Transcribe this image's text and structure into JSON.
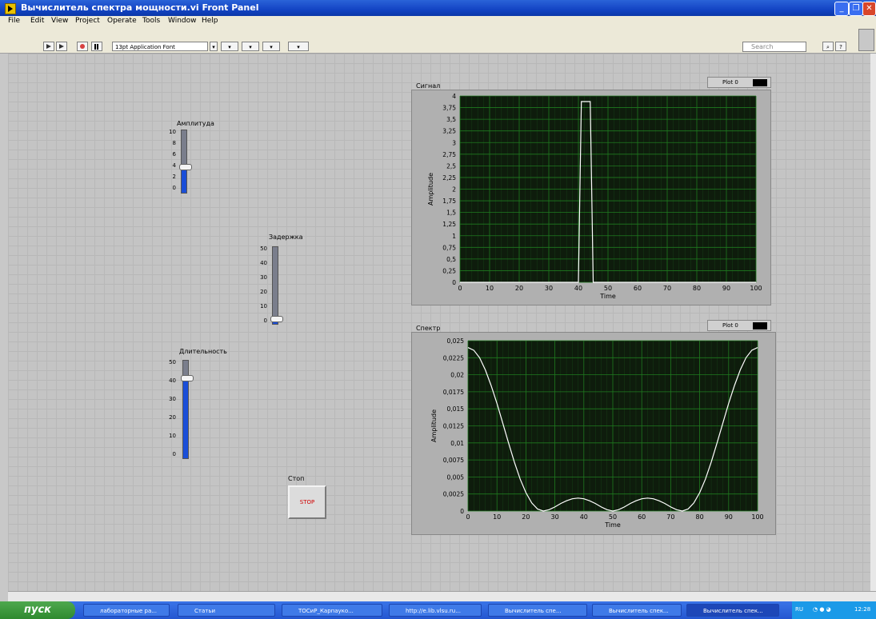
{
  "window": {
    "title": "Вычислитель спектра мощности.vi Front Panel"
  },
  "menu": [
    "File",
    "Edit",
    "View",
    "Project",
    "Operate",
    "Tools",
    "Window",
    "Help"
  ],
  "toolbar": {
    "font": "13pt Application Font",
    "search_placeholder": "Search"
  },
  "controls": {
    "amplitude": {
      "label": "Амплитуда",
      "ticks": [
        "10",
        "8",
        "6",
        "4",
        "2",
        "0"
      ],
      "value": 4
    },
    "delay": {
      "label": "Задержка",
      "ticks": [
        "50",
        "40",
        "30",
        "20",
        "10",
        "0"
      ],
      "value": 3
    },
    "duration": {
      "label": "Длительность",
      "ticks": [
        "50",
        "40",
        "30",
        "20",
        "10",
        "0"
      ],
      "value": 42
    },
    "stop": {
      "label": "Стоп",
      "button": "STOP"
    }
  },
  "chart_data": [
    {
      "type": "line",
      "title": "Сигнал",
      "legend": "Plot 0",
      "xlabel": "Time",
      "ylabel": "Amplitude",
      "xlim": [
        0,
        100
      ],
      "ylim": [
        0,
        4
      ],
      "xticks": [
        "0",
        "10",
        "20",
        "30",
        "40",
        "50",
        "60",
        "70",
        "80",
        "90",
        "100"
      ],
      "yticks": [
        "0",
        "0,25",
        "0,5",
        "0,75",
        "1",
        "1,25",
        "1,5",
        "1,75",
        "2",
        "2,25",
        "2,5",
        "2,75",
        "3",
        "3,25",
        "3,5",
        "3,75",
        "4"
      ],
      "series": [
        {
          "x": [
            0,
            40,
            41,
            44,
            45,
            100
          ],
          "y": [
            0,
            0,
            3.88,
            3.88,
            0,
            0
          ]
        }
      ]
    },
    {
      "type": "line",
      "title": "Спектр",
      "legend": "Plot 0",
      "xlabel": "Time",
      "ylabel": "Amplitude",
      "xlim": [
        0,
        100
      ],
      "ylim": [
        0,
        0.025
      ],
      "xticks": [
        "0",
        "10",
        "20",
        "30",
        "40",
        "50",
        "60",
        "70",
        "80",
        "90",
        "100"
      ],
      "yticks": [
        "0",
        "0,0025",
        "0,005",
        "0,0075",
        "0,01",
        "0,0125",
        "0,015",
        "0,0175",
        "0,02",
        "0,0225",
        "0,025"
      ],
      "series": [
        {
          "x": [
            0,
            2,
            4,
            6,
            8,
            10,
            12,
            14,
            16,
            18,
            20,
            22,
            24,
            26,
            28,
            30,
            32,
            34,
            36,
            38,
            40,
            42,
            44,
            46,
            48,
            50,
            52,
            54,
            56,
            58,
            60,
            62,
            64,
            66,
            68,
            70,
            72,
            74,
            76,
            78,
            80,
            82,
            84,
            86,
            88,
            90,
            92,
            94,
            96,
            98,
            100
          ],
          "y": [
            0.024,
            0.0236,
            0.0225,
            0.0207,
            0.0184,
            0.0158,
            0.0129,
            0.01,
            0.0072,
            0.0047,
            0.0027,
            0.0012,
            0.0003,
            0.0,
            0.0002,
            0.0006,
            0.0011,
            0.0015,
            0.0018,
            0.0019,
            0.0018,
            0.0015,
            0.0011,
            0.0006,
            0.0002,
            0.0,
            0.0002,
            0.0006,
            0.0011,
            0.0015,
            0.0018,
            0.0019,
            0.0018,
            0.0015,
            0.0011,
            0.0006,
            0.0002,
            0.0,
            0.0003,
            0.0012,
            0.0027,
            0.0047,
            0.0072,
            0.01,
            0.0129,
            0.0158,
            0.0184,
            0.0207,
            0.0225,
            0.0236,
            0.024
          ]
        }
      ]
    }
  ],
  "taskbar": {
    "start": "пуск",
    "items": [
      "лабораторные ра...",
      "Статьи",
      "ТОСиР_Карпауко...",
      "http://e.lib.vlsu.ru...",
      "Вычислитель спе...",
      "Вычислитель спек...",
      "Вычислитель спек..."
    ],
    "lang": "RU",
    "time": "12:28"
  },
  "colors": {
    "plot_bg": "#0e1c0c",
    "grid": "#1f7a1f",
    "trace": "#ffffff",
    "slider_fill": "#1a4ed8",
    "stop_text": "#d00000"
  }
}
